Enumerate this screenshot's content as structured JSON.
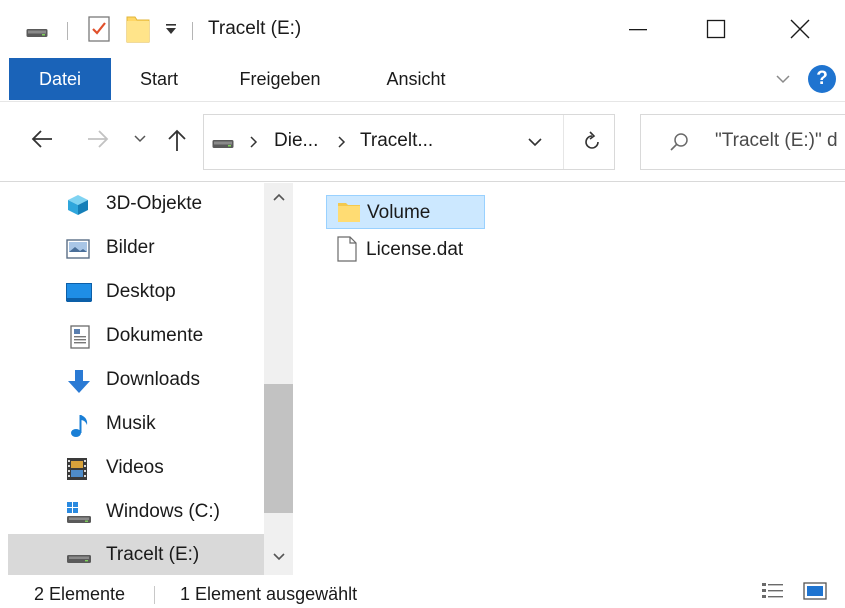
{
  "window": {
    "title": "Tracelt (E:)"
  },
  "ribbon": {
    "tabs": [
      {
        "label": "Datei"
      },
      {
        "label": "Start"
      },
      {
        "label": "Freigeben"
      },
      {
        "label": "Ansicht"
      }
    ],
    "help_label": "?"
  },
  "address": {
    "crumbs": [
      "Die...",
      "Tracelt..."
    ]
  },
  "search": {
    "placeholder": "\"Tracelt (E:)\" d"
  },
  "navpane": {
    "items": [
      {
        "label": "3D-Objekte",
        "icon": "cube-icon"
      },
      {
        "label": "Bilder",
        "icon": "pictures-icon"
      },
      {
        "label": "Desktop",
        "icon": "desktop-icon"
      },
      {
        "label": "Dokumente",
        "icon": "documents-icon"
      },
      {
        "label": "Downloads",
        "icon": "download-arrow-icon"
      },
      {
        "label": "Musik",
        "icon": "music-note-icon"
      },
      {
        "label": "Videos",
        "icon": "film-icon"
      },
      {
        "label": "Windows (C:)",
        "icon": "system-drive-icon"
      },
      {
        "label": "Tracelt (E:)",
        "icon": "drive-icon",
        "selected": true
      }
    ]
  },
  "content": {
    "items": [
      {
        "name": "Volume",
        "icon": "folder-icon",
        "selected": true
      },
      {
        "name": "License.dat",
        "icon": "file-icon",
        "selected": false
      }
    ]
  },
  "status": {
    "count": "2 Elemente",
    "selection": "1 Element ausgewählt"
  },
  "colors": {
    "accent": "#1a63b8",
    "selection_fill": "#cce8ff",
    "selection_border": "#99d1ff",
    "nav_selected": "#d9d9d9"
  }
}
